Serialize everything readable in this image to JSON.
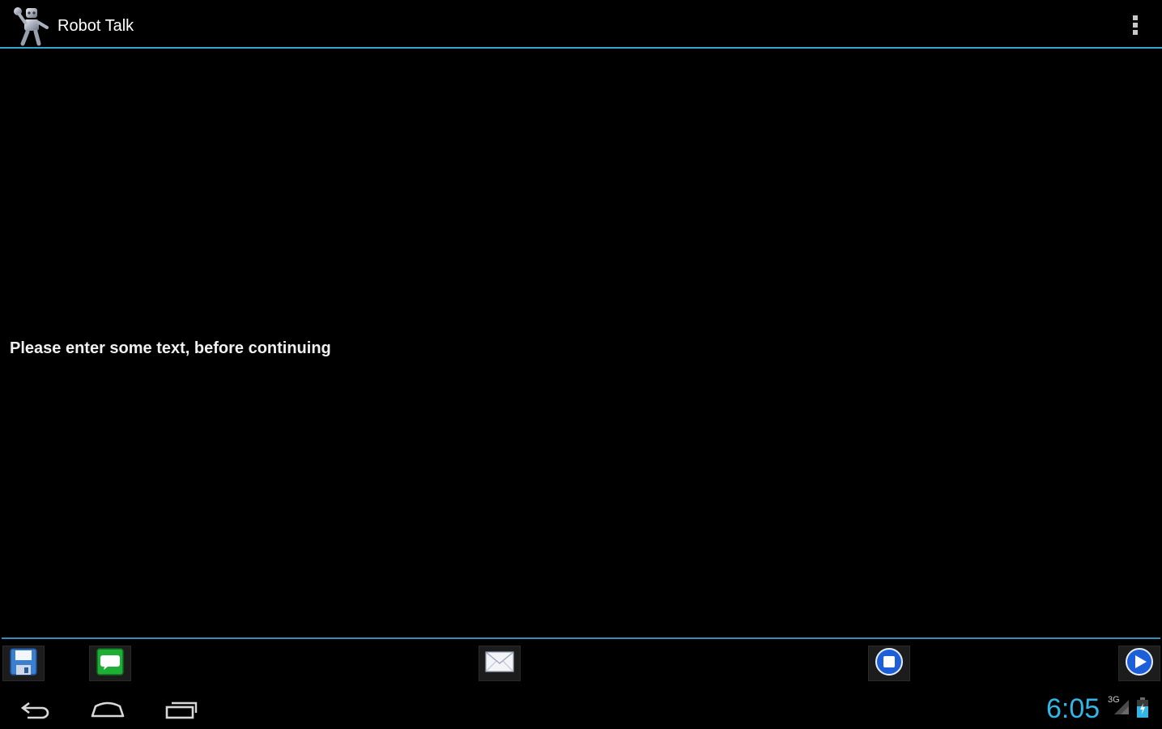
{
  "action_bar": {
    "title": "Robot Talk",
    "app_icon": "robot-icon",
    "menu_icon": "overflow-menu-icon"
  },
  "content": {
    "message": "Please enter some text, before continuing"
  },
  "toolbar": {
    "buttons": [
      {
        "icon": "save-icon"
      },
      {
        "icon": "sms-icon"
      },
      {
        "icon": "email-icon"
      },
      {
        "icon": "stop-icon"
      },
      {
        "icon": "play-icon"
      }
    ]
  },
  "system_bar": {
    "time": "6:05",
    "network": "3G",
    "nav_icons": [
      "back-icon",
      "home-icon",
      "recent-apps-icon"
    ]
  },
  "colors": {
    "accent": "#33b5e5",
    "divider": "#33a5d0",
    "background": "#000000"
  }
}
